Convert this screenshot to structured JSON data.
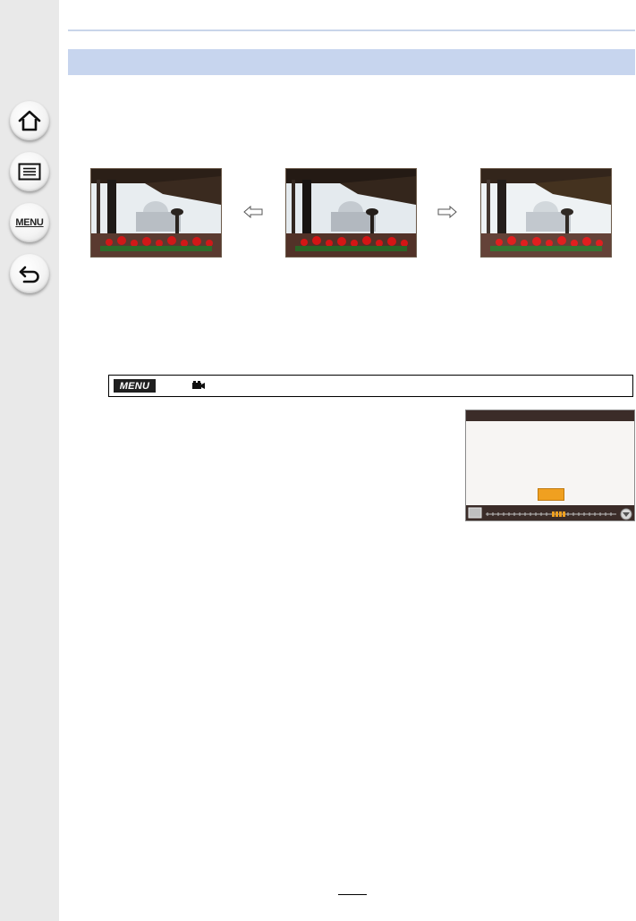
{
  "sidebar": {
    "items": [
      {
        "icon": "home-icon"
      },
      {
        "icon": "list-icon"
      },
      {
        "icon": "menu-icon",
        "label": "MENU"
      },
      {
        "icon": "back-icon"
      }
    ]
  },
  "menu_path": {
    "badge_label": "MENU",
    "icon": "motion-picture-icon"
  },
  "colors": {
    "sidebar_bg": "#e9e9e9",
    "section_bar": "#c7d5ee",
    "highlight": "#f0a020",
    "screen_frame": "#3b2c28"
  }
}
